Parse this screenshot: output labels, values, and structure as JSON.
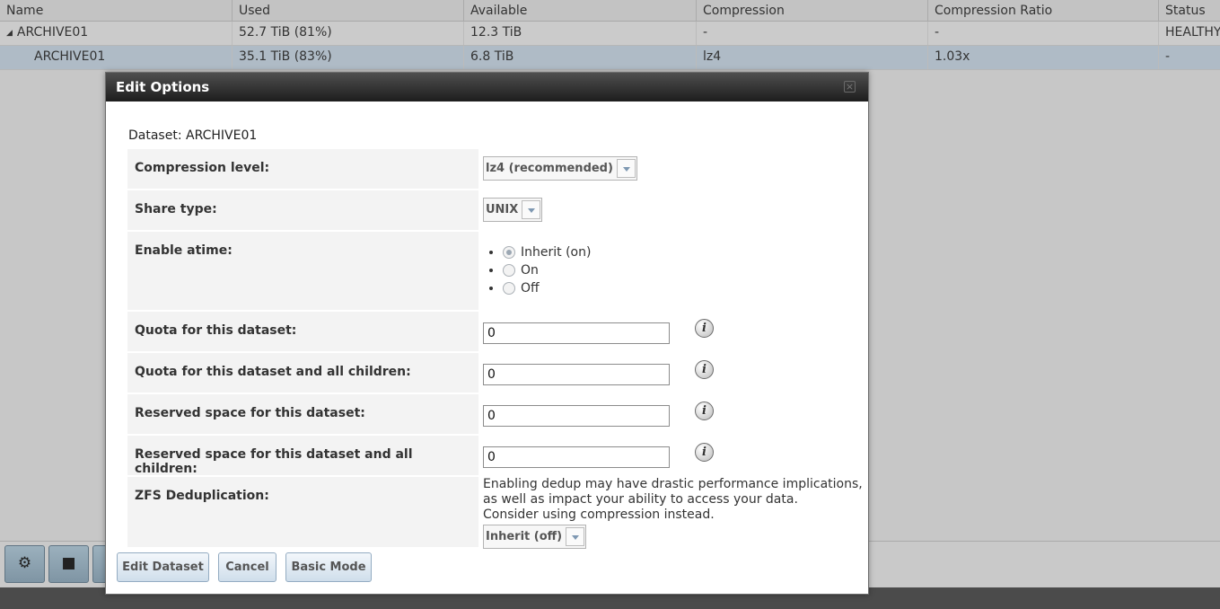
{
  "grid": {
    "columns": [
      "Name",
      "Used",
      "Available",
      "Compression",
      "Compression Ratio",
      "Status"
    ],
    "rows": [
      {
        "name": "ARCHIVE01",
        "used": "52.7 TiB (81%)",
        "available": "12.3 TiB",
        "compression": "-",
        "ratio": "-",
        "status": "HEALTHY"
      },
      {
        "name": "ARCHIVE01",
        "used": "35.1 TiB (83%)",
        "available": "6.8 TiB",
        "compression": "lz4",
        "ratio": "1.03x",
        "status": "-"
      }
    ]
  },
  "toolbar": {
    "icons": [
      "dataset-settings-icon",
      "add-dataset-icon"
    ]
  },
  "modal": {
    "title": "Edit Options",
    "dataset_line": "Dataset: ARCHIVE01",
    "fields": {
      "compression": {
        "label": "Compression level:",
        "value": "lz4 (recommended)"
      },
      "share_type": {
        "label": "Share type:",
        "value": "UNIX"
      },
      "atime": {
        "label": "Enable atime:",
        "options": [
          "Inherit (on)",
          "On",
          "Off"
        ],
        "selected": "Inherit (on)"
      },
      "quota": {
        "label": "Quota for this dataset:",
        "value": "0"
      },
      "quota_children": {
        "label": "Quota for this dataset and all children:",
        "value": "0"
      },
      "reserved": {
        "label": "Reserved space for this dataset:",
        "value": "0"
      },
      "reserved_children": {
        "label": "Reserved space for this dataset and all children:",
        "value": "0"
      },
      "dedup": {
        "label": "ZFS Deduplication:",
        "warning": [
          "Enabling dedup may have drastic performance implications,",
          "as well as impact your ability to access your data.",
          "Consider using compression instead."
        ],
        "value": "Inherit (off)"
      }
    },
    "buttons": {
      "edit": "Edit Dataset",
      "cancel": "Cancel",
      "basic": "Basic Mode"
    }
  }
}
